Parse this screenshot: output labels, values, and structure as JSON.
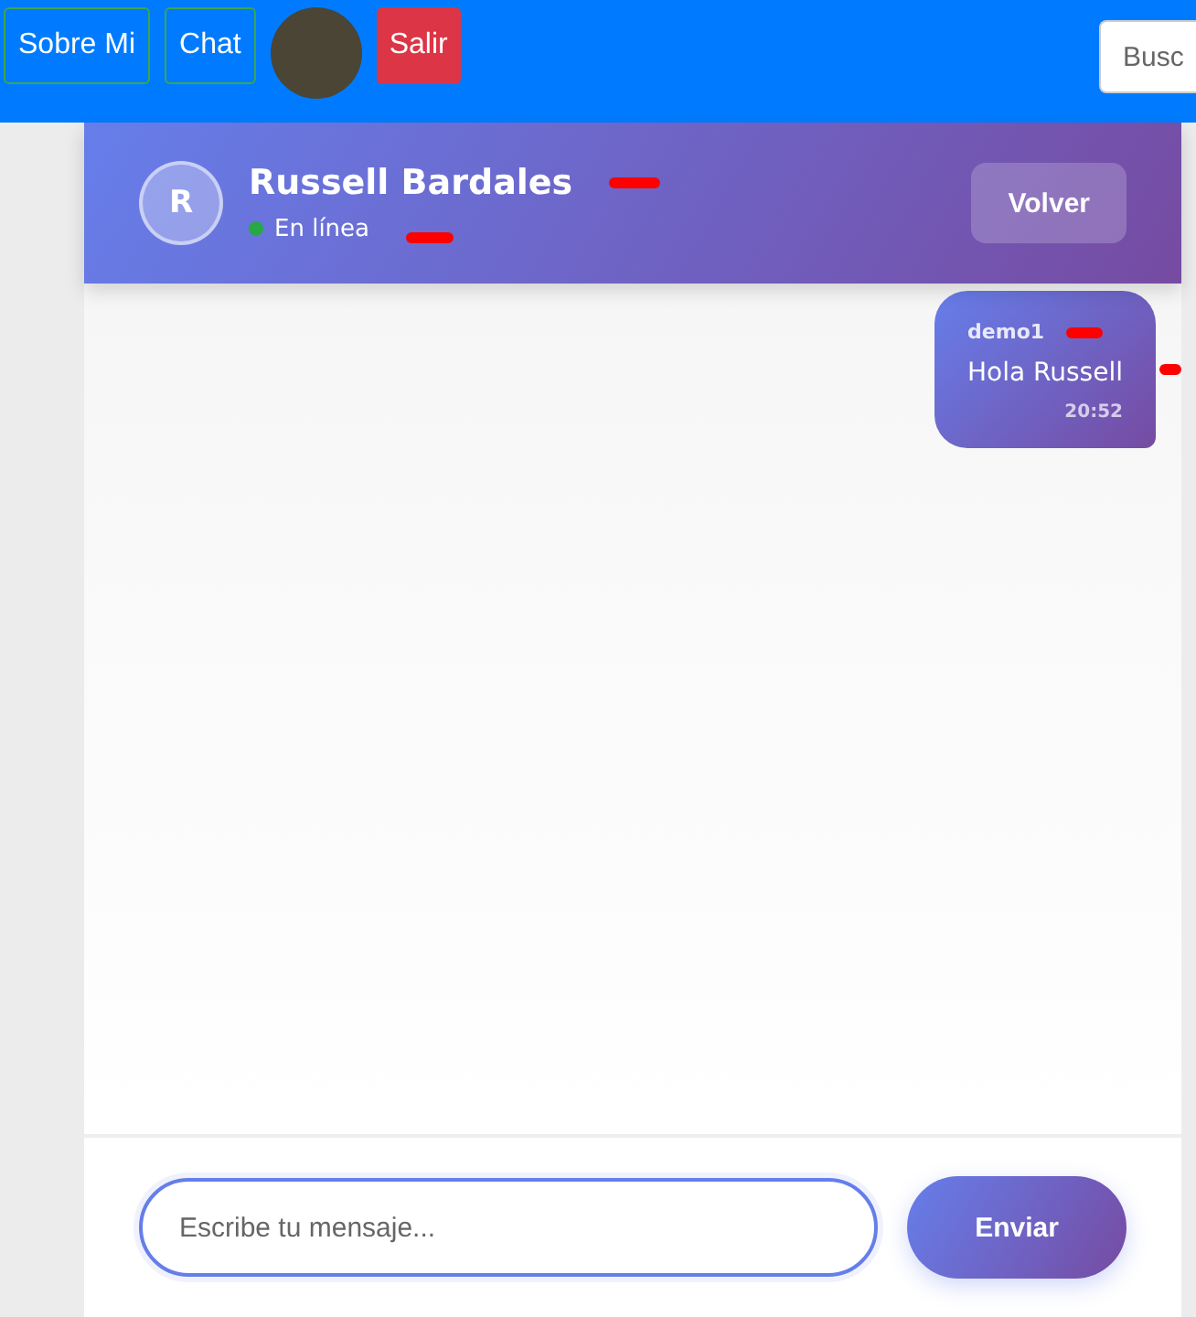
{
  "navbar": {
    "buttons": [
      {
        "label": "Sobre Mi",
        "kind": "outline"
      },
      {
        "label": "Chat",
        "kind": "outline"
      },
      {
        "kind": "avatar"
      },
      {
        "label": "Salir",
        "kind": "danger"
      }
    ],
    "search": {
      "placeholder": "Busc"
    }
  },
  "chat": {
    "contact": {
      "initial": "R",
      "name": "Russell Bardales",
      "status": "En línea",
      "color": "#28a745"
    },
    "back_button": "Volver",
    "messages": [
      {
        "sender": "demo1",
        "text": "Hola Russell",
        "time": "20:52",
        "own": true
      }
    ],
    "composer": {
      "placeholder": "Escribe tu mensaje...",
      "send_button": "Enviar"
    }
  }
}
